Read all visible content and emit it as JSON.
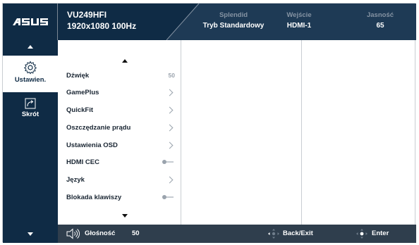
{
  "brand": {
    "logo_text": "ASUS"
  },
  "header": {
    "model": "VU249HFI",
    "resolution": "1920x1080 100Hz",
    "info": [
      {
        "label": "Splendid",
        "value": "Tryb Standardowy"
      },
      {
        "label": "Wejście",
        "value": "HDMI-1"
      },
      {
        "label": "Jasność",
        "value": "65"
      }
    ]
  },
  "sidebar": {
    "items": [
      {
        "label": "Ustawien.",
        "icon": "gear-icon",
        "active": true
      },
      {
        "label": "Skrót",
        "icon": "shortcut-icon",
        "active": false
      }
    ]
  },
  "menu": {
    "items": [
      {
        "label": "Dźwięk",
        "value": "50",
        "control": "value"
      },
      {
        "label": "GamePlus",
        "value": "",
        "control": "chevron"
      },
      {
        "label": "QuickFit",
        "value": "",
        "control": "chevron"
      },
      {
        "label": "Oszczędzanie prądu",
        "value": "",
        "control": "chevron"
      },
      {
        "label": "Ustawienia OSD",
        "value": "",
        "control": "chevron"
      },
      {
        "label": "HDMI CEC",
        "value": "",
        "control": "toggle-off"
      },
      {
        "label": "Język",
        "value": "",
        "control": "chevron"
      },
      {
        "label": "Blokada klawiszy",
        "value": "",
        "control": "toggle-off"
      }
    ]
  },
  "footer": {
    "volume_label": "Głośność",
    "volume_value": "50",
    "back_label": "Back/Exit",
    "enter_label": "Enter"
  },
  "colors": {
    "navy": "#0f2b45",
    "header_right": "#1e3a55",
    "footer": "#2f3e4d",
    "muted": "#9aa3ad"
  }
}
